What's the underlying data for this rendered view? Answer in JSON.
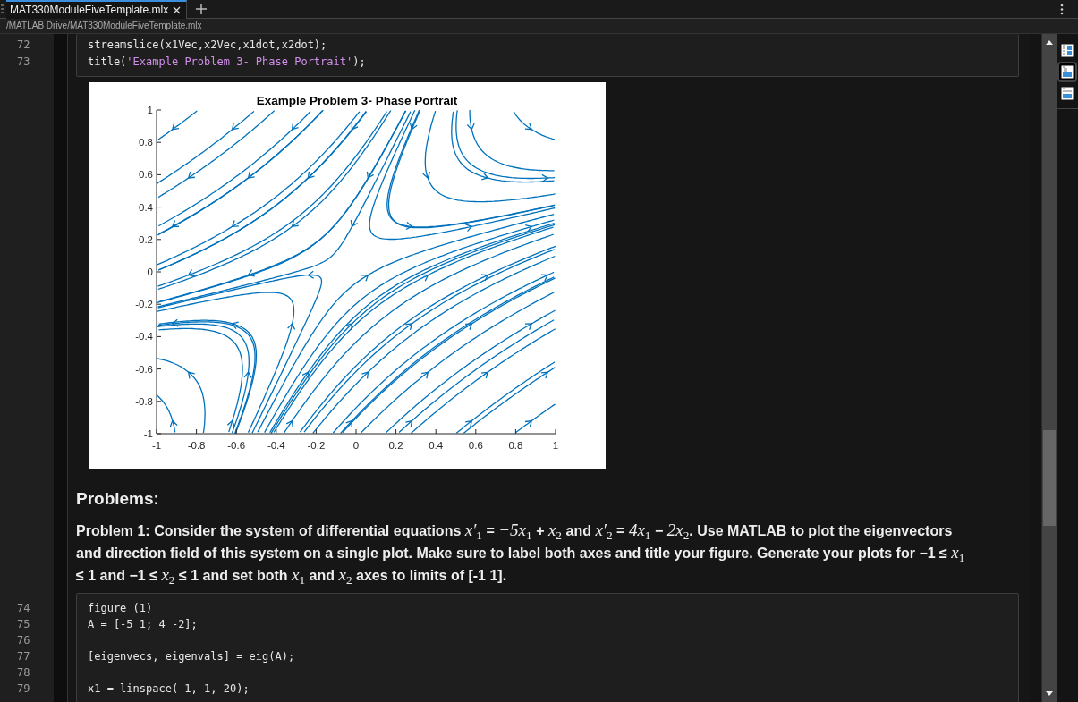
{
  "tabs": [
    {
      "label": "MAT330ModuleFiveTemplate.mlx",
      "selected": true
    }
  ],
  "path": "/MATLAB Drive/MAT330ModuleFiveTemplate.mlx",
  "code_block_1": [
    {
      "number": "72",
      "segments": [
        {
          "kind": "plain",
          "text": "streamslice(x1Vec,x2Vec,x1dot,x2dot);"
        }
      ]
    },
    {
      "number": "73",
      "segments": [
        {
          "kind": "plain",
          "text": "title("
        },
        {
          "kind": "string",
          "text": "'Example Problem 3- Phase Portrait'"
        },
        {
          "kind": "plain",
          "text": ");"
        }
      ]
    }
  ],
  "figure": {
    "title": "Example Problem 3- Phase Portrait",
    "x_ticks": [
      "-1",
      "-0.8",
      "-0.6",
      "-0.4",
      "-0.2",
      "0",
      "0.2",
      "0.4",
      "0.6",
      "0.8",
      "1"
    ],
    "y_ticks": [
      "1",
      "0.8",
      "0.6",
      "0.4",
      "0.2",
      "0",
      "-0.2",
      "-0.4",
      "-0.6",
      "-0.8",
      "-1"
    ]
  },
  "heading": "Problems:",
  "paragraph": "Problem 1: Consider the system of differential equations *x′*$_{1}$ = *−5x*$_{1}$ + *x*$_{2}$ and *x′*$_{2}$ = *4x*$_{1}$ − *2x*$_{2}$. Use MATLAB to plot the eigenvectors and direction field of this system on a single plot. Make sure to label both axes and title your figure. Generate your plots for −1 ≤ *x*$_{1}$ ≤ 1 and −1 ≤ *x*$_{2}$ ≤ 1 and set both *x*$_{1}$ and *x*$_{2}$ axes to limits of [-1 1].",
  "code_block_2": [
    {
      "number": "74",
      "segments": [
        {
          "kind": "plain",
          "text": "figure (1)"
        }
      ]
    },
    {
      "number": "75",
      "segments": [
        {
          "kind": "plain",
          "text": "A = [-5 1; 4 -2];"
        }
      ]
    },
    {
      "number": "76"
    },
    {
      "number": "77",
      "segments": [
        {
          "kind": "plain",
          "text": "[eigenvecs, eigenvals] = eig(A);"
        }
      ]
    },
    {
      "number": "78"
    },
    {
      "number": "79",
      "segments": [
        {
          "kind": "plain",
          "text": "x1 = linspace(-1, 1, 20);"
        }
      ]
    }
  ]
}
